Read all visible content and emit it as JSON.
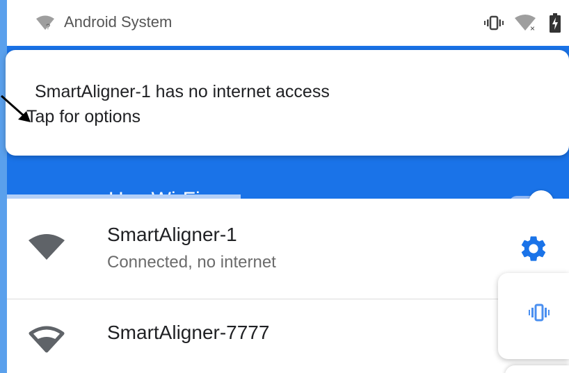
{
  "status_bar": {
    "app_name": "Android System",
    "icons": [
      "wifi-question-icon",
      "vibrate-icon",
      "wifi-no-connection-icon",
      "battery-charging-icon"
    ]
  },
  "notification": {
    "title": "SmartAligner-1 has no internet access",
    "subtitle": "Tap for options"
  },
  "header": {
    "title": "Use Wi-Fi",
    "toggle_on": true,
    "accent_color": "#1a73e8"
  },
  "networks": [
    {
      "name": "SmartAligner-1",
      "status": "Connected, no internet",
      "icon": "wifi-full-icon",
      "action_icon": "gear-icon"
    },
    {
      "name": "SmartAligner-7777",
      "status": "",
      "icon": "wifi-outline-icon"
    }
  ],
  "quick_panel": {
    "icon": "vibrate-icon"
  }
}
